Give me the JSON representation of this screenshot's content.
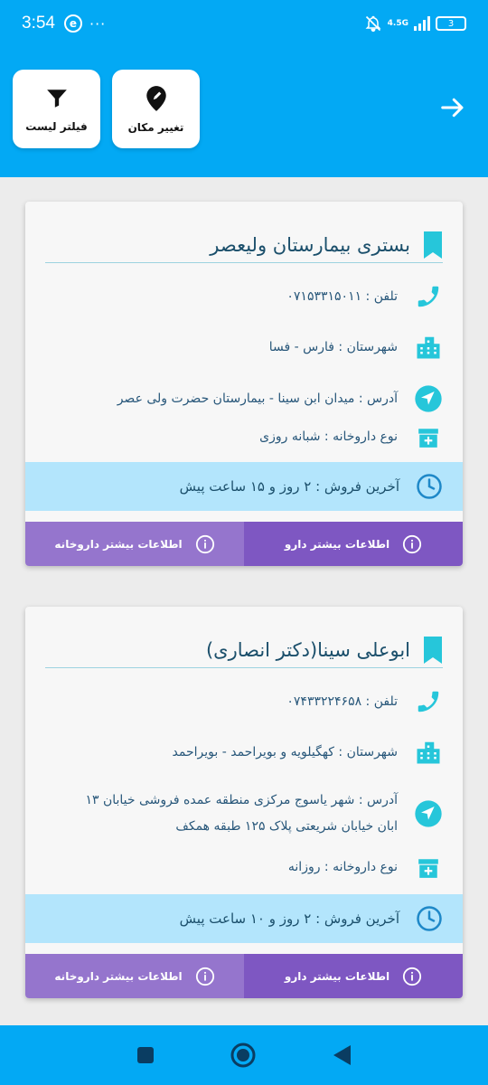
{
  "status_bar": {
    "time": "3:54",
    "app_icon": "e",
    "dots": "···",
    "network": "4.5G",
    "battery": "3"
  },
  "header": {
    "filter_label": "فیلتر لیست",
    "location_label": "تغییر مکان"
  },
  "cards": [
    {
      "title": "بستری بیمارستان ولیعصر",
      "phone": "تلفن : ۰۷۱۵۳۳۱۵۰۱۱",
      "city": "شهرستان : فارس - فسا",
      "address": "آدرس : میدان ابن سینا - بیمارستان حضرت ولی عصر",
      "type": "نوع داروخانه : شبانه روزی",
      "last_sale": "آخرین فروش : ۲ روز و ۱۵ ساعت پیش",
      "btn_drug": "اطلاعات بیشتر دارو",
      "btn_pharmacy": "اطلاعات بیشتر داروخانه"
    },
    {
      "title": "ابوعلی سینا(دکتر انصاری)",
      "phone": "تلفن : ۰۷۴۳۳۲۲۴۶۵۸",
      "city": "شهرستان : کهگیلویه و بویراحمد - بویراحمد",
      "address": "آدرس : شهر یاسوج مرکزی منطقه عمده فروشی خیابان ۱۳ ابان خیابان شریعتی پلاک ۱۲۵ طبقه همکف",
      "type": "نوع داروخانه : روزانه",
      "last_sale": "آخرین فروش : ۲ روز و ۱۰ ساعت پیش",
      "btn_drug": "اطلاعات بیشتر دارو",
      "btn_pharmacy": "اطلاعات بیشتر داروخانه"
    }
  ],
  "colors": {
    "primary": "#03a9f4",
    "accent_purple": "#7e57c2",
    "light_purple": "#9575cd",
    "sale_bg": "#b3e5fc",
    "icon_teal": "#26c6da",
    "text_blue": "#28577a"
  }
}
